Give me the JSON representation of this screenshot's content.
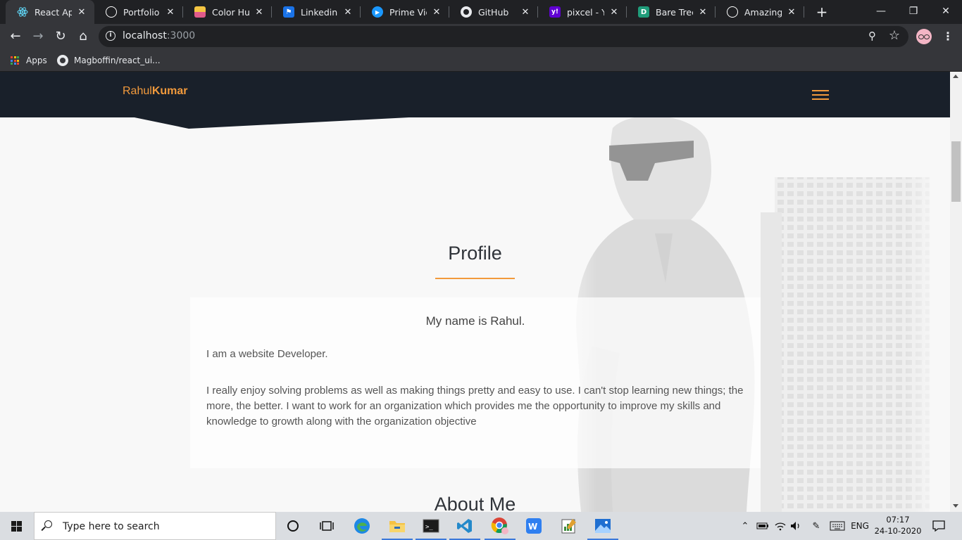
{
  "browser": {
    "tabs": [
      {
        "title": "React App",
        "icon": "react-icon",
        "color": "#61dafb",
        "active": true
      },
      {
        "title": "Portfolio Pa",
        "icon": "codepen-icon",
        "color": "#ffffff",
        "active": false
      },
      {
        "title": "Color Hunt",
        "icon": "colorhunt-icon",
        "color": "#f4c542",
        "active": false
      },
      {
        "title": "Linkedin In",
        "icon": "flag-icon",
        "color": "#1a73e8",
        "active": false
      },
      {
        "title": "Prime Video",
        "icon": "play-icon",
        "color": "#1a98ff",
        "active": false
      },
      {
        "title": "GitHub",
        "icon": "github-icon",
        "color": "#ffffff",
        "active": false
      },
      {
        "title": "pixcel - Yah",
        "icon": "yahoo-icon",
        "color": "#6001d2",
        "active": false
      },
      {
        "title": "Bare Tree in",
        "icon": "d-icon",
        "color": "#1f9c7a",
        "active": false
      },
      {
        "title": "Amazing ca",
        "icon": "codepen-icon",
        "color": "#ffffff",
        "active": false
      }
    ],
    "url_host": "localhost",
    "url_port": ":3000",
    "bookmarks": [
      {
        "label": "Apps",
        "icon": "apps-grid-icon"
      },
      {
        "label": "Magboffin/react_ui...",
        "icon": "github-icon"
      }
    ]
  },
  "page": {
    "brand": {
      "first": "Rahul",
      "last": "Kumar"
    },
    "accent_color": "#f29a3c",
    "nav_bg": "#19202a",
    "profile": {
      "title": "Profile",
      "intro": "My name is Rahul.",
      "line1": "I am a website Developer.",
      "paragraph": "I really enjoy solving problems as well as making things pretty and easy to use. I can't stop learning new things; the more, the better. I want to work for an organization which provides me the opportunity to improve my skills and knowledge to growth along with the organization objective"
    },
    "about_title": "About Me"
  },
  "taskbar": {
    "search_placeholder": "Type here to search",
    "apps": [
      {
        "name": "cortana-icon",
        "running": false
      },
      {
        "name": "task-view-icon",
        "running": false
      },
      {
        "name": "edge-icon",
        "running": false
      },
      {
        "name": "file-explorer-icon",
        "running": true
      },
      {
        "name": "terminal-icon",
        "running": true
      },
      {
        "name": "vscode-icon",
        "running": true
      },
      {
        "name": "chrome-icon",
        "running": true
      },
      {
        "name": "wps-icon",
        "running": false
      },
      {
        "name": "notepad-icon",
        "running": false
      },
      {
        "name": "photos-icon",
        "running": true
      }
    ],
    "lang": "ENG",
    "time": "07:17",
    "date": "24-10-2020"
  }
}
